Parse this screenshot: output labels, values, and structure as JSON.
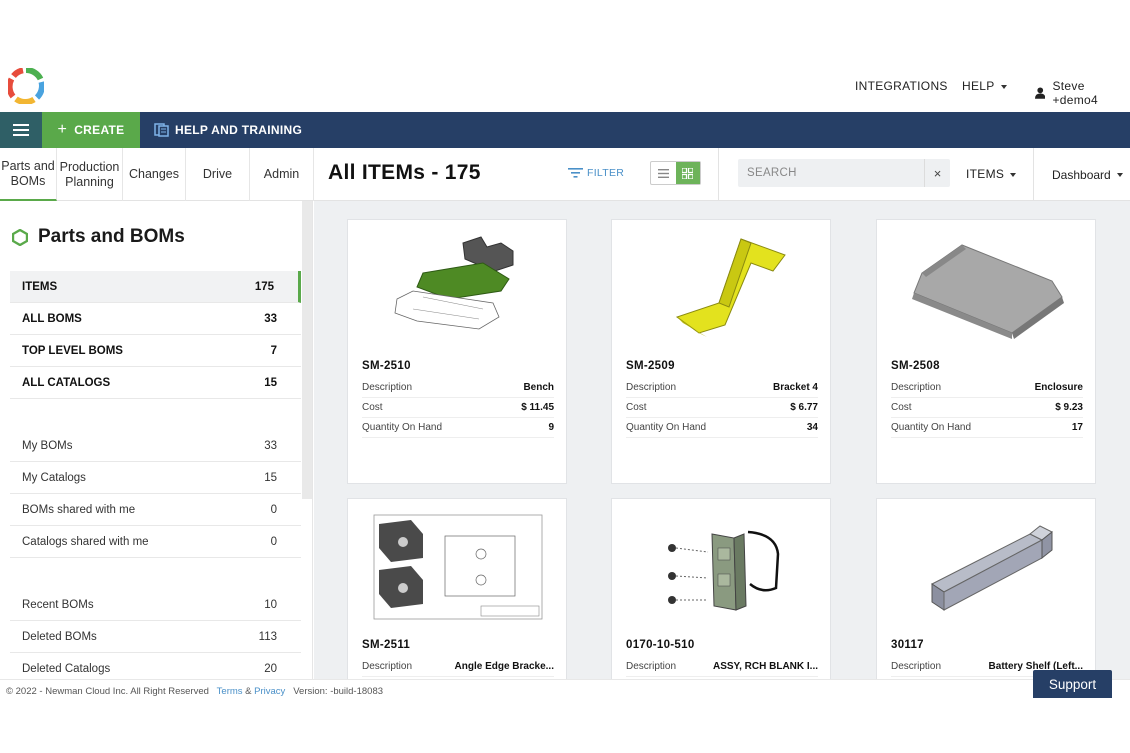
{
  "header": {
    "integrations": "INTEGRATIONS",
    "help": "HELP",
    "user": "Steve +demo4"
  },
  "navbar": {
    "create": "CREATE",
    "help_training": "HELP AND TRAINING"
  },
  "module_tabs": [
    {
      "label_line1": "Parts and",
      "label_line2": "BOMs"
    },
    {
      "label_line1": "Production",
      "label_line2": "Planning"
    },
    {
      "label_line1": "Changes",
      "label_line2": ""
    },
    {
      "label_line1": "Drive",
      "label_line2": ""
    },
    {
      "label_line1": "Admin",
      "label_line2": ""
    }
  ],
  "toolbar": {
    "title": "All ITEMs - 175",
    "filter": "FILTER",
    "search_placeholder": "SEARCH",
    "clear": "×",
    "items_dropdown": "ITEMS",
    "dashboard_dropdown": "Dashboard"
  },
  "sidebar": {
    "title": "Parts and BOMs",
    "primary": [
      {
        "label": "ITEMS",
        "count": "175"
      },
      {
        "label": "ALL BOMS",
        "count": "33"
      },
      {
        "label": "TOP LEVEL BOMS",
        "count": "7"
      },
      {
        "label": "ALL CATALOGS",
        "count": "15"
      }
    ],
    "mine": [
      {
        "label": "My BOMs",
        "count": "33"
      },
      {
        "label": "My Catalogs",
        "count": "15"
      },
      {
        "label": "BOMs shared with me",
        "count": "0"
      },
      {
        "label": "Catalogs shared with me",
        "count": "0"
      }
    ],
    "other": [
      {
        "label": "Recent BOMs",
        "count": "10"
      },
      {
        "label": "Deleted BOMs",
        "count": "113"
      },
      {
        "label": "Deleted Catalogs",
        "count": "20"
      }
    ]
  },
  "field_labels": {
    "description": "Description",
    "cost": "Cost",
    "qty": "Quantity On Hand"
  },
  "cards": [
    {
      "id": "SM-2510",
      "description": "Bench",
      "cost": "$ 11.45",
      "qty": "9"
    },
    {
      "id": "SM-2509",
      "description": "Bracket 4",
      "cost": "$ 6.77",
      "qty": "34"
    },
    {
      "id": "SM-2508",
      "description": "Enclosure",
      "cost": "$ 9.23",
      "qty": "17"
    },
    {
      "id": "SM-2511",
      "description": "Angle Edge Bracke..."
    },
    {
      "id": "0170-10-510",
      "description": "ASSY, RCH BLANK I..."
    },
    {
      "id": "30117",
      "description": "Battery Shelf (Left..."
    }
  ],
  "footer": {
    "copyright": "© 2022 - Newman Cloud Inc. All Right Reserved",
    "terms": "Terms",
    "amp": "&",
    "privacy": "Privacy",
    "version": "Version: -build-18083"
  },
  "support": "Support",
  "colors": {
    "navy": "#263f66",
    "green": "#5aa94a",
    "link": "#4a90c8"
  }
}
